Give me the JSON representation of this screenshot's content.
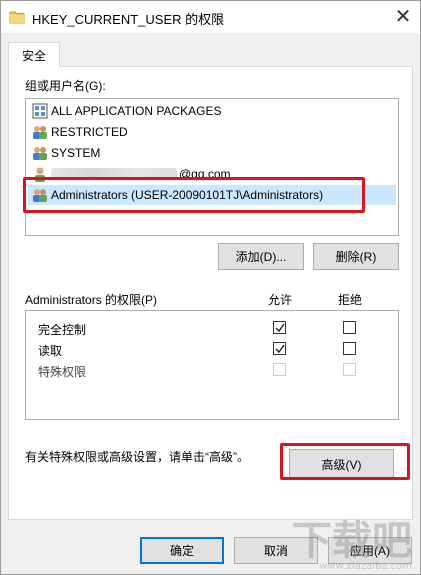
{
  "window": {
    "title": "HKEY_CURRENT_USER 的权限",
    "close_glyph": "✕"
  },
  "tabs": [
    {
      "label": "安全",
      "active": true
    }
  ],
  "group_section": {
    "label": "组或用户名(G):",
    "users": [
      {
        "name": "ALL APPLICATION PACKAGES",
        "icon": "app-packages-icon",
        "selected": false
      },
      {
        "name": "RESTRICTED",
        "icon": "group-icon",
        "selected": false
      },
      {
        "name": "SYSTEM",
        "icon": "group-icon",
        "selected": false
      },
      {
        "name": "@qq.com",
        "icon": "user-icon",
        "selected": false,
        "obscured_prefix": true
      },
      {
        "name": "Administrators (USER-20090101TJ\\Administrators)",
        "icon": "group-icon",
        "selected": true
      }
    ],
    "add_button": "添加(D)...",
    "remove_button": "删除(R)"
  },
  "permissions": {
    "label": "Administrators 的权限(P)",
    "allow_header": "允许",
    "deny_header": "拒绝",
    "rows": [
      {
        "name": "完全控制",
        "allow": true,
        "deny": false,
        "disabled": false
      },
      {
        "name": "读取",
        "allow": true,
        "deny": false,
        "disabled": false
      },
      {
        "name": "特殊权限",
        "allow": false,
        "deny": false,
        "disabled": true
      }
    ]
  },
  "advanced": {
    "text": "有关特殊权限或高级设置，请单击“高级”。",
    "button": "高级(V)"
  },
  "footer": {
    "ok": "确定",
    "cancel": "取消",
    "apply": "应用(A)"
  },
  "colors": {
    "highlight": "#d9141c",
    "selection": "#cce8ff",
    "focus_blue": "#0078d7"
  },
  "watermark": {
    "big": "下载吧",
    "small": "www.xiazaiba.com"
  }
}
